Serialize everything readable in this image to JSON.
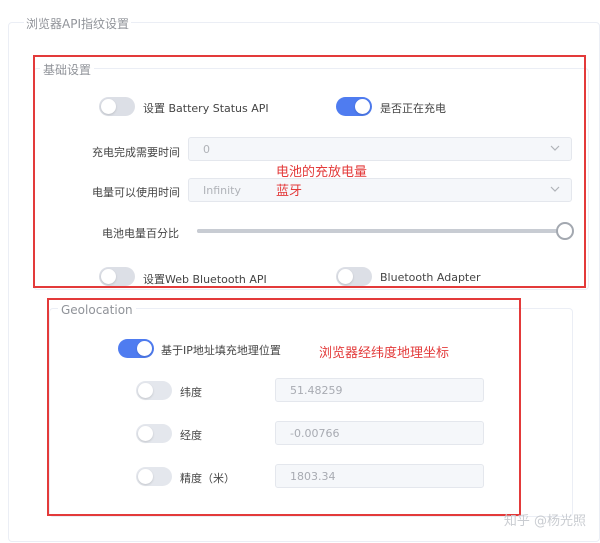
{
  "page": {
    "title": "浏览器API指纹设置"
  },
  "battery": {
    "legend": "基础设置",
    "enable_toggle": {
      "label": "设置 Battery Status API",
      "on": false
    },
    "charging_toggle": {
      "label": "是否正在充电",
      "on": true
    },
    "charge_time": {
      "label": "充电完成需要时间",
      "value": "0"
    },
    "discharge_time": {
      "label": "电量可以使用时间",
      "value": "Infinity"
    },
    "level": {
      "label": "电池电量百分比",
      "value": 1.0
    },
    "annotation_line1": "电池的充放电量",
    "annotation_line2": "蓝牙"
  },
  "bluetooth": {
    "enable_toggle": {
      "label": "设置Web Bluetooth API",
      "on": false
    },
    "adapter_toggle": {
      "label": "Bluetooth Adapter",
      "on": false
    }
  },
  "geolocation": {
    "legend": "Geolocation",
    "ip_toggle": {
      "label": "基于IP地址填充地理位置",
      "on": true
    },
    "annotation": "浏览器经纬度地理坐标",
    "latitude": {
      "label": "纬度",
      "value": "51.48259"
    },
    "longitude": {
      "label": "经度",
      "value": "-0.00766"
    },
    "accuracy": {
      "label": "精度（米）",
      "value": "1803.34"
    }
  },
  "watermark": "知乎 @杨光照",
  "colors": {
    "accent": "#4f7cf0",
    "annotation_red": "#e33a3a"
  },
  "icons": [
    "chevron-down-icon"
  ]
}
